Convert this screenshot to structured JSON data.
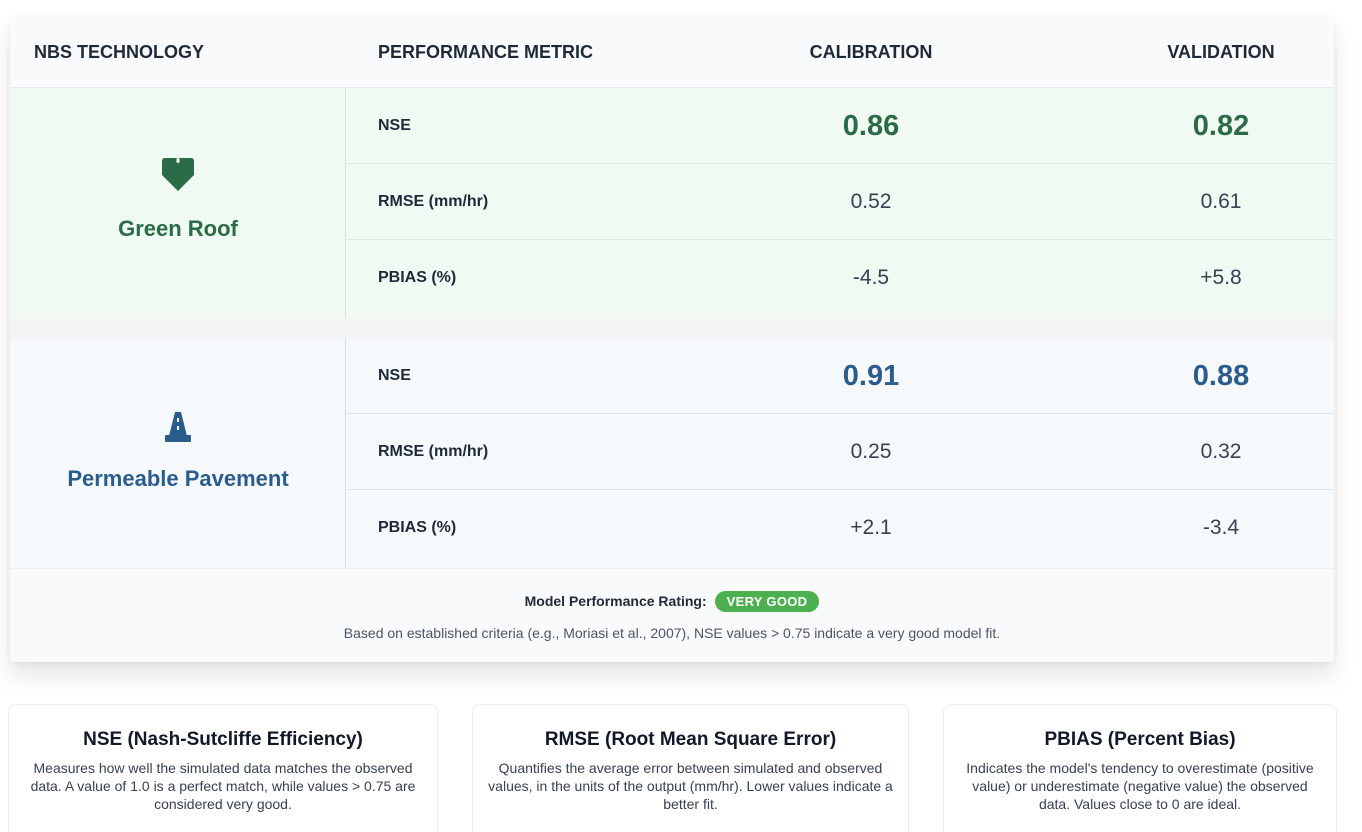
{
  "table": {
    "headers": {
      "technology": "NBS TECHNOLOGY",
      "metric": "PERFORMANCE METRIC",
      "calibration": "CALIBRATION",
      "validation": "VALIDATION"
    },
    "groups": [
      {
        "technology": "Green Roof",
        "icon": "leaf-roof-icon",
        "color": "#2b6b47",
        "rows": [
          {
            "metric": "NSE",
            "calibration": "0.86",
            "validation": "0.82"
          },
          {
            "metric": "RMSE (mm/hr)",
            "calibration": "0.52",
            "validation": "0.61"
          },
          {
            "metric": "PBIAS (%)",
            "calibration": "-4.5",
            "validation": "+5.8"
          }
        ]
      },
      {
        "technology": "Permeable Pavement",
        "icon": "road-icon",
        "color": "#2b5d8c",
        "rows": [
          {
            "metric": "NSE",
            "calibration": "0.91",
            "validation": "0.88"
          },
          {
            "metric": "RMSE (mm/hr)",
            "calibration": "0.25",
            "validation": "0.32"
          },
          {
            "metric": "PBIAS (%)",
            "calibration": "+2.1",
            "validation": "-3.4"
          }
        ]
      }
    ]
  },
  "footer": {
    "rating_label": "Model Performance Rating:",
    "rating_badge": "VERY GOOD",
    "badge_color": "#4caf50",
    "criteria": "Based on established criteria (e.g., Moriasi et al., 2007), NSE values > 0.75 indicate a very good model fit."
  },
  "definitions": [
    {
      "title": "NSE (Nash-Sutcliffe Efficiency)",
      "text": "Measures how well the simulated data matches the observed data. A value of 1.0 is a perfect match, while values > 0.75 are considered very good."
    },
    {
      "title": "RMSE (Root Mean Square Error)",
      "text": "Quantifies the average error between simulated and observed values, in the units of the output (mm/hr). Lower values indicate a better fit."
    },
    {
      "title": "PBIAS (Percent Bias)",
      "text": "Indicates the model's tendency to overestimate (positive value) or underestimate (negative value) the observed data. Values close to 0 are ideal."
    }
  ]
}
